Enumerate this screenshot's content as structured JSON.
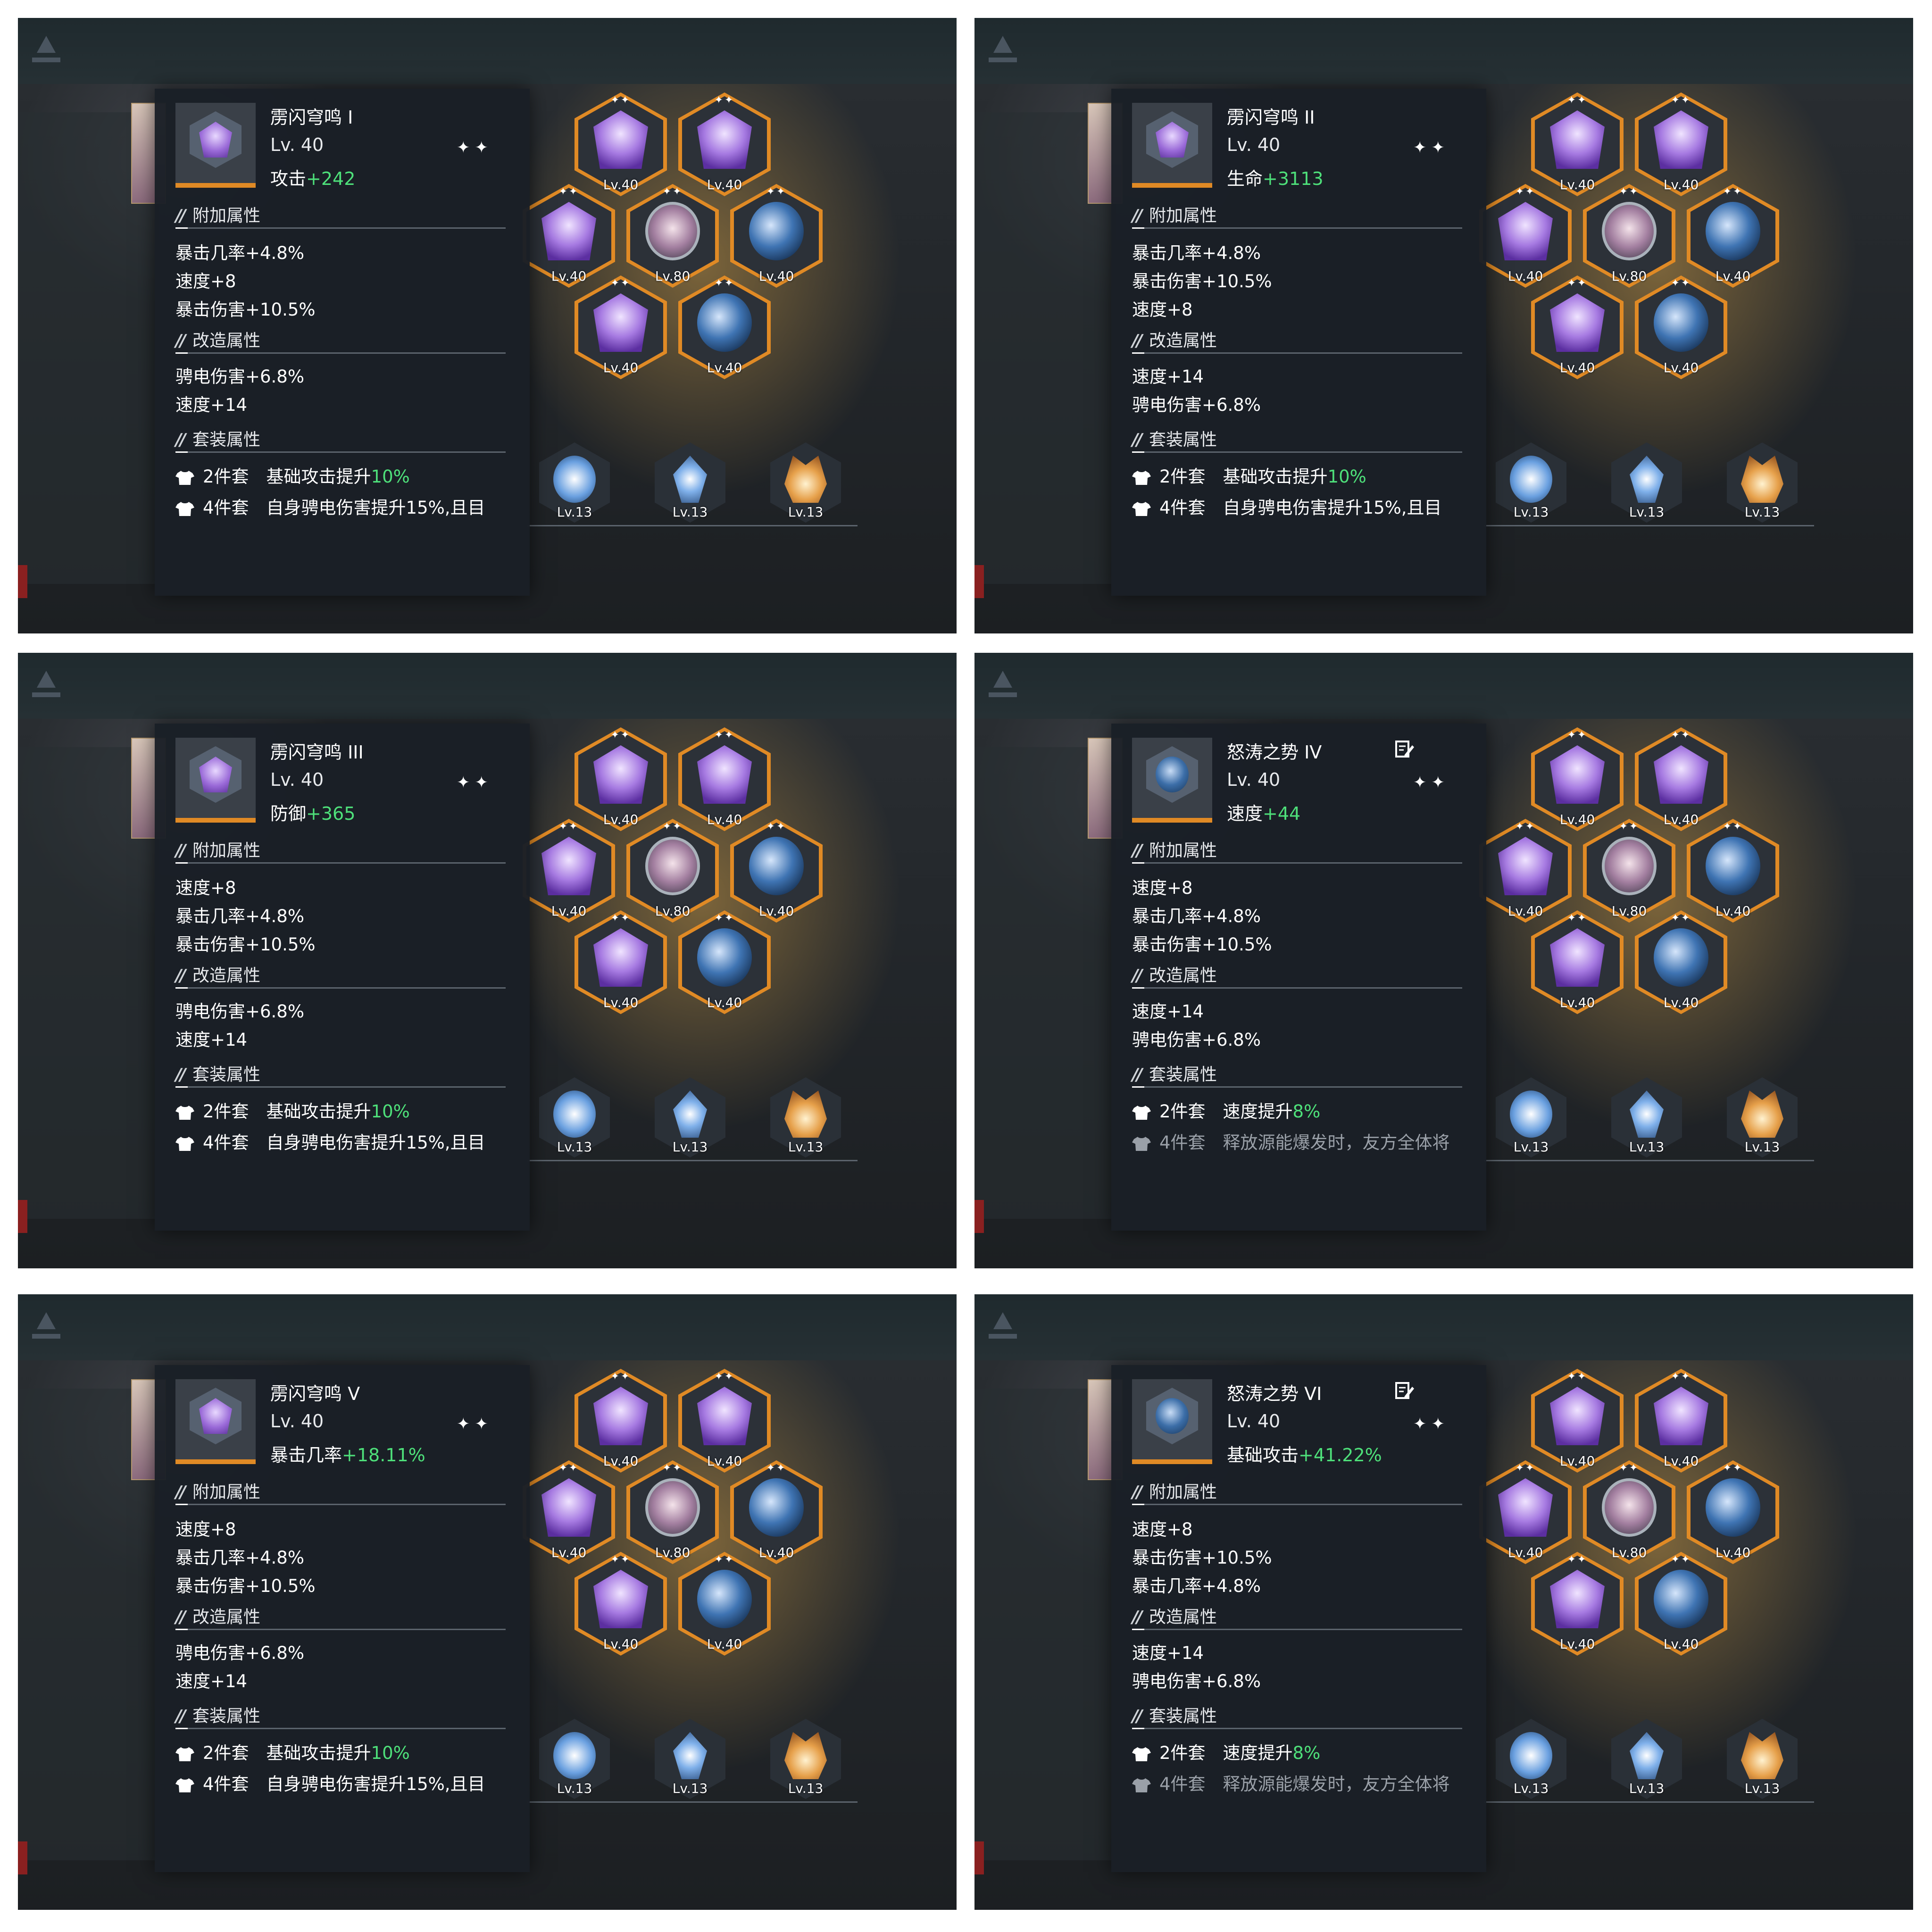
{
  "common": {
    "sections": {
      "sub": "附加属性",
      "reform": "改造属性",
      "set": "套装属性"
    },
    "grid_levels": [
      "Lv.40",
      "Lv.40",
      "Lv.40",
      "Lv.80",
      "Lv.40",
      "Lv.40",
      "Lv.40"
    ],
    "skill_levels": [
      "Lv.13",
      "Lv.13",
      "Lv.13"
    ],
    "stars": "✦✦",
    "colors": {
      "accent_orange": "#e08a25",
      "value_green": "#4ee07a",
      "panel_bg": "#1a1f26"
    },
    "icons": {
      "gear_purple": "thunder-crest-icon",
      "gear_blue": "raging-wave-icon",
      "edit": "edit-note-icon",
      "set": "shirt-icon"
    }
  },
  "panels": [
    {
      "name": "雳闪穹鸣 I",
      "level": "Lv. 40",
      "main_label": "攻击",
      "main_value": "+242",
      "icon": "purple",
      "edit": false,
      "sub": [
        "暴击几率+4.8%",
        "速度+8",
        "暴击伤害+10.5%"
      ],
      "reform": [
        "骋电伤害+6.8%",
        "速度+14"
      ],
      "set2_label": "2件套",
      "set2_text": "基础攻击提升",
      "set2_value": "10%",
      "set4_label": "4件套",
      "set4_text": "自身骋电伤害提升15%,且目",
      "set4_dim": false
    },
    {
      "name": "雳闪穹鸣 II",
      "level": "Lv. 40",
      "main_label": "生命",
      "main_value": "+3113",
      "icon": "purple",
      "edit": false,
      "sub": [
        "暴击几率+4.8%",
        "暴击伤害+10.5%",
        "速度+8"
      ],
      "reform": [
        "速度+14",
        "骋电伤害+6.8%"
      ],
      "set2_label": "2件套",
      "set2_text": "基础攻击提升",
      "set2_value": "10%",
      "set4_label": "4件套",
      "set4_text": "自身骋电伤害提升15%,且目",
      "set4_dim": false
    },
    {
      "name": "雳闪穹鸣 III",
      "level": "Lv. 40",
      "main_label": "防御",
      "main_value": "+365",
      "icon": "purple",
      "edit": false,
      "sub": [
        "速度+8",
        "暴击几率+4.8%",
        "暴击伤害+10.5%"
      ],
      "reform": [
        "骋电伤害+6.8%",
        "速度+14"
      ],
      "set2_label": "2件套",
      "set2_text": "基础攻击提升",
      "set2_value": "10%",
      "set4_label": "4件套",
      "set4_text": "自身骋电伤害提升15%,且目",
      "set4_dim": false
    },
    {
      "name": "怒涛之势 IV",
      "level": "Lv. 40",
      "main_label": "速度",
      "main_value": "+44",
      "icon": "blue",
      "edit": true,
      "sub": [
        "速度+8",
        "暴击几率+4.8%",
        "暴击伤害+10.5%"
      ],
      "reform": [
        "速度+14",
        "骋电伤害+6.8%"
      ],
      "set2_label": "2件套",
      "set2_text": "速度提升",
      "set2_value": "8%",
      "set4_label": "4件套",
      "set4_text": "释放源能爆发时，友方全体将",
      "set4_dim": true
    },
    {
      "name": "雳闪穹鸣 V",
      "level": "Lv. 40",
      "main_label": "暴击几率",
      "main_value": "+18.11%",
      "icon": "purple",
      "edit": false,
      "sub": [
        "速度+8",
        "暴击几率+4.8%",
        "暴击伤害+10.5%"
      ],
      "reform": [
        "骋电伤害+6.8%",
        "速度+14"
      ],
      "set2_label": "2件套",
      "set2_text": "基础攻击提升",
      "set2_value": "10%",
      "set4_label": "4件套",
      "set4_text": "自身骋电伤害提升15%,且目",
      "set4_dim": false
    },
    {
      "name": "怒涛之势 VI",
      "level": "Lv. 40",
      "main_label": "基础攻击",
      "main_value": "+41.22%",
      "icon": "blue",
      "edit": true,
      "sub": [
        "速度+8",
        "暴击伤害+10.5%",
        "暴击几率+4.8%"
      ],
      "reform": [
        "速度+14",
        "骋电伤害+6.8%"
      ],
      "set2_label": "2件套",
      "set2_text": "速度提升",
      "set2_value": "8%",
      "set4_label": "4件套",
      "set4_text": "释放源能爆发时，友方全体将",
      "set4_dim": true
    }
  ]
}
